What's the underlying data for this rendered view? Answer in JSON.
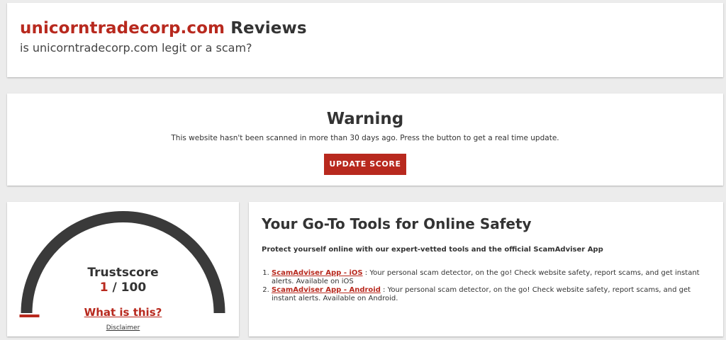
{
  "header": {
    "domain": "unicorntradecorp.com",
    "title_suffix": " Reviews",
    "subtitle": "is unicorntradecorp.com legit or a scam?"
  },
  "warning": {
    "title": "Warning",
    "text": "This website hasn't been scanned in more than 30 days ago. Press the button to get a real time update.",
    "button_label": "UPDATE SCORE"
  },
  "trust": {
    "label": "Trustscore",
    "score": "1",
    "max": " / 100",
    "score_fraction": 0.01,
    "what_link": "What is this?",
    "disclaimer": "Disclaimer",
    "colors": {
      "gauge_track": "#3a3a3a",
      "gauge_fill": "#b8291e"
    }
  },
  "tools": {
    "title": "Your Go-To Tools for Online Safety",
    "intro": "Protect yourself online with our expert-vetted tools and the official ScamAdviser App",
    "items": [
      {
        "link": "ScamAdviser App - iOS",
        "text": " : Your personal scam detector, on the go! Check website safety, report scams, and get instant alerts. Available on iOS"
      },
      {
        "link": "ScamAdviser App - Android",
        "text": " : Your personal scam detector, on the go! Check website safety, report scams, and get instant alerts. Available on Android."
      }
    ]
  },
  "colors": {
    "accent": "#b8291e",
    "background": "#ececec",
    "card": "#ffffff"
  }
}
